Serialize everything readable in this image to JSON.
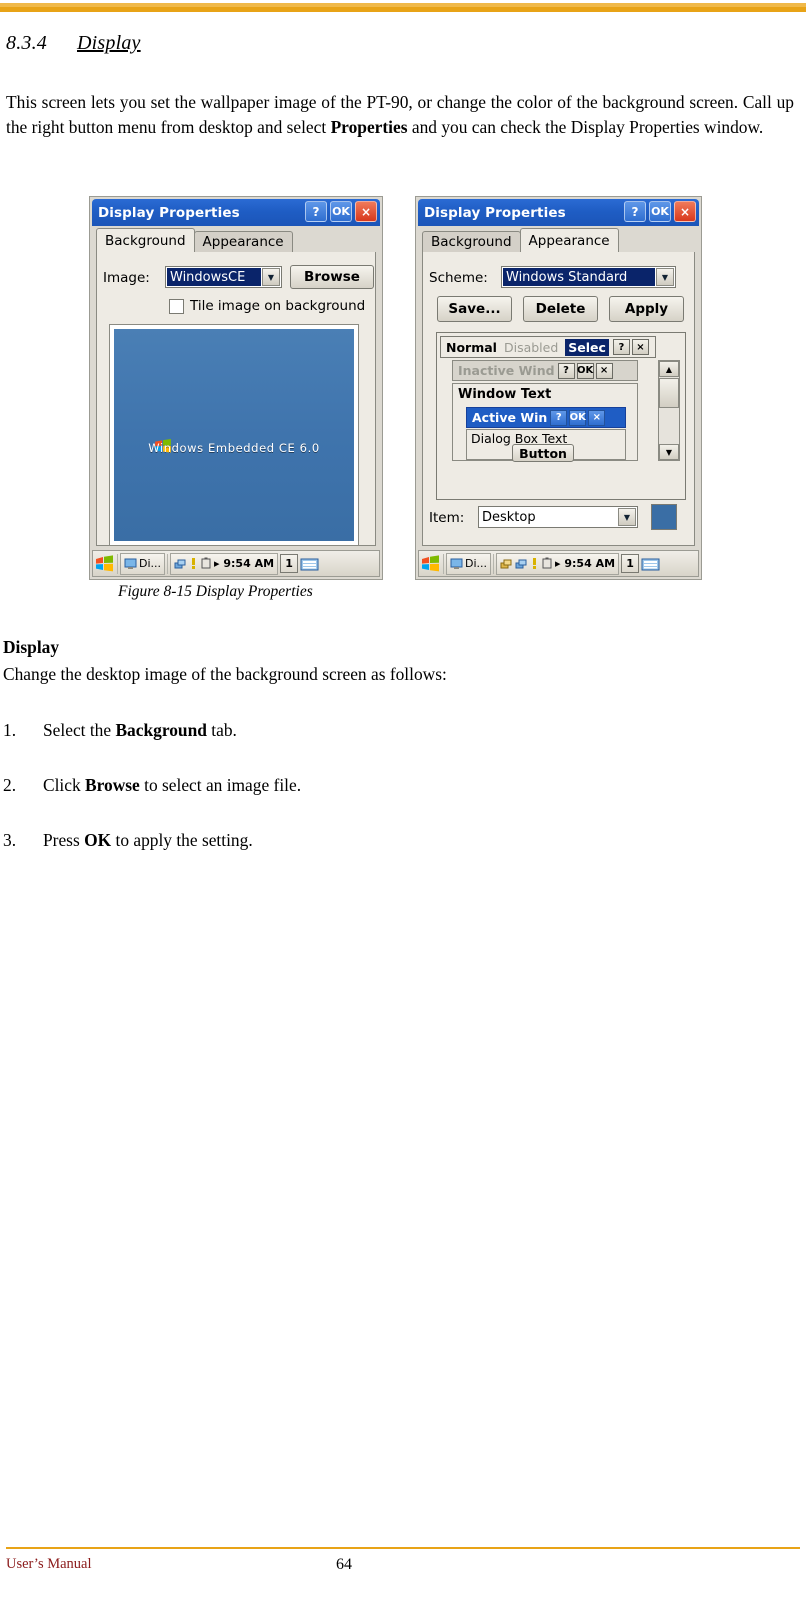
{
  "document": {
    "section_number": "8.3.4",
    "section_title": "Display",
    "intro_html": "This screen lets you set the wallpaper image of the PT-90, or change the color of the background screen. Call up the right button menu from desktop and select <b>Properties</b> and you can check the Display Properties window.",
    "figure_caption": "Figure 8-15 Display Properties",
    "display_heading": "Display",
    "display_desc": "Change the desktop image of the background screen as follows:",
    "steps": [
      {
        "num": "1.",
        "html": "Select the <b>Background</b> tab."
      },
      {
        "num": "2.",
        "html": "Click <b>Browse</b> to select an image file."
      },
      {
        "num": "3.",
        "html": "Press <b>OK</b> to apply the setting."
      }
    ],
    "footer_left": "User’s Manual",
    "footer_page": "64"
  },
  "screenshot_left": {
    "title": "Display Properties",
    "title_buttons": {
      "help": "?",
      "ok": "OK",
      "close": "×"
    },
    "tabs": [
      {
        "label": "Background",
        "active": true
      },
      {
        "label": "Appearance",
        "active": false
      }
    ],
    "image_label": "Image:",
    "image_value": "WindowsCE",
    "browse_button": "Browse",
    "tile_checkbox_label": "Tile image on background",
    "wallpaper_text": "Windows Embedded CE 6.0",
    "taskbar": {
      "task_label": "Di...",
      "time": "9:54 AM",
      "desk_number": "1"
    }
  },
  "screenshot_right": {
    "title": "Display Properties",
    "title_buttons": {
      "help": "?",
      "ok": "OK",
      "close": "×"
    },
    "tabs": [
      {
        "label": "Background",
        "active": false
      },
      {
        "label": "Appearance",
        "active": true
      }
    ],
    "scheme_label": "Scheme:",
    "scheme_value": "Windows Standard",
    "buttons": {
      "save": "Save...",
      "delete": "Delete",
      "apply": "Apply"
    },
    "preview": {
      "normal": "Normal",
      "disabled": "Disabled",
      "selected": "Selec",
      "inactive_window": "Inactive Wind",
      "window_text": "Window Text",
      "active_window": "Active Win",
      "dialog_box_text": "Dialog Box Text",
      "button": "Button",
      "help_btn": "?",
      "ok_btn": "OK",
      "close_btn": "×"
    },
    "item_label": "Item:",
    "item_value": "Desktop",
    "color_swatch": "#3a6ea5",
    "taskbar": {
      "task_label": "Di...",
      "time": "9:54 AM",
      "desk_number": "1"
    }
  },
  "colors": {
    "rule": "#e8a317",
    "title_bar": "#1f5dc4",
    "selection": "#0a246a",
    "wallpaper": "#3a6ea5",
    "footer_text": "#8b1a1a"
  }
}
